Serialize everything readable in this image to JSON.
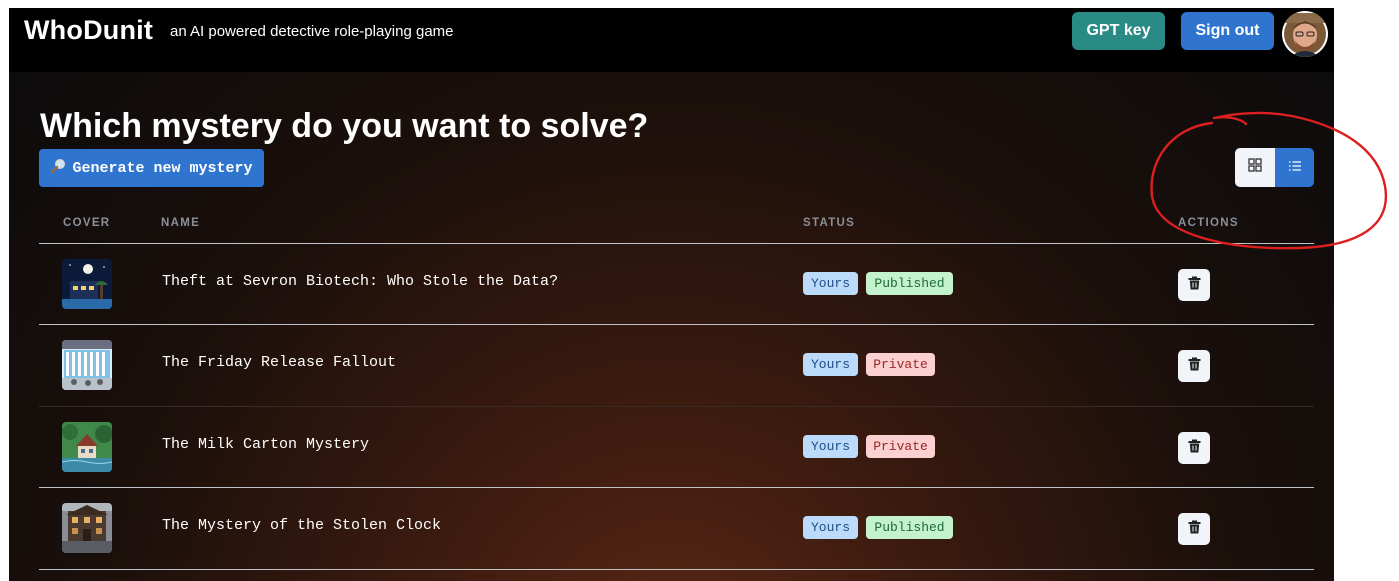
{
  "header": {
    "brand": "WhoDunit",
    "tagline": "an AI powered detective role-playing game",
    "gpt_key_label": "GPT key",
    "sign_out_label": "Sign out"
  },
  "main": {
    "title": "Which mystery do you want to solve?",
    "generate_label": "Generate new mystery",
    "generate_icon": "magnifying-glass-emoji",
    "view_toggle": {
      "active": "list",
      "options": [
        "grid",
        "list"
      ]
    },
    "columns": [
      "COVER",
      "NAME",
      "STATUS",
      "ACTIONS"
    ],
    "rows": [
      {
        "name": "Theft at Sevron Biotech: Who Stole the Data?",
        "owner_badge": "Yours",
        "status_badge": "Published"
      },
      {
        "name": "The Friday Release Fallout",
        "owner_badge": "Yours",
        "status_badge": "Private"
      },
      {
        "name": "The Milk Carton Mystery",
        "owner_badge": "Yours",
        "status_badge": "Private"
      },
      {
        "name": "The Mystery of the Stolen Clock",
        "owner_badge": "Yours",
        "status_badge": "Published"
      }
    ]
  },
  "colors": {
    "primary": "#2f75cf",
    "teal": "#2a8a85",
    "annotation_red": "#dc1f1f",
    "badge_yours_bg": "#bcdbfb",
    "badge_published_bg": "#c4f2cd",
    "badge_private_bg": "#fbd0d0"
  }
}
